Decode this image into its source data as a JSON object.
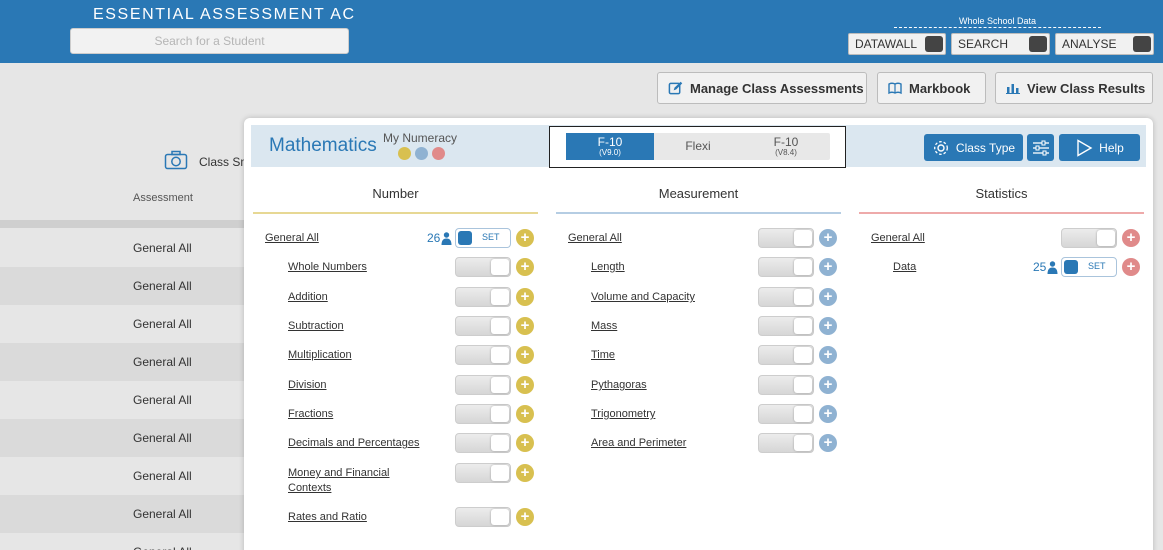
{
  "header": {
    "brand": "ESSENTIAL ASSESSMENT AC",
    "search_placeholder": "Search for a Student",
    "whole_school_label": "Whole School Data",
    "toggles": [
      "DATAWALL",
      "SEARCH",
      "ANALYSE"
    ]
  },
  "toolbar": {
    "manage": "Manage Class Assessments",
    "markbook": "Markbook",
    "results": "View Class Results"
  },
  "background": {
    "class_label": "Class Sm",
    "assessment_header": "Assessment",
    "rows": [
      "General All",
      "General All",
      "General All",
      "General All",
      "General All",
      "General All",
      "General All",
      "General All",
      "General All"
    ]
  },
  "modal": {
    "title": "Mathematics",
    "my_numeracy": "My Numeracy",
    "colors": {
      "accent": "#2a78b5",
      "number": "#d8c050",
      "measurement": "#8fb2d2",
      "statistics": "#e08a8a"
    },
    "curriculum": {
      "v9": {
        "label": "F-10",
        "sub": "(V9.0)"
      },
      "flexi": "Flexi",
      "v84": {
        "label": "F-10",
        "sub": "(V8.4)"
      },
      "selected": "F-10 (V9.0)"
    },
    "class_type": "Class Type",
    "help": "Help",
    "columns": [
      {
        "name": "Number",
        "items": [
          {
            "label": "General All",
            "count": "26",
            "set_label": "SET"
          },
          {
            "label": "Whole Numbers"
          },
          {
            "label": "Addition"
          },
          {
            "label": "Subtraction"
          },
          {
            "label": "Multiplication"
          },
          {
            "label": "Division"
          },
          {
            "label": "Fractions"
          },
          {
            "label": "Decimals and Percentages"
          },
          {
            "label": "Money and Financial Contexts"
          },
          {
            "label": "Rates and Ratio"
          }
        ]
      },
      {
        "name": "Measurement",
        "items": [
          {
            "label": "General All"
          },
          {
            "label": "Length"
          },
          {
            "label": "Volume and Capacity"
          },
          {
            "label": "Mass"
          },
          {
            "label": "Time"
          },
          {
            "label": "Pythagoras"
          },
          {
            "label": "Trigonometry"
          },
          {
            "label": "Area and Perimeter"
          }
        ]
      },
      {
        "name": "Statistics",
        "items": [
          {
            "label": "General All"
          },
          {
            "label": "Data",
            "count": "25",
            "set_label": "SET"
          }
        ]
      }
    ]
  }
}
